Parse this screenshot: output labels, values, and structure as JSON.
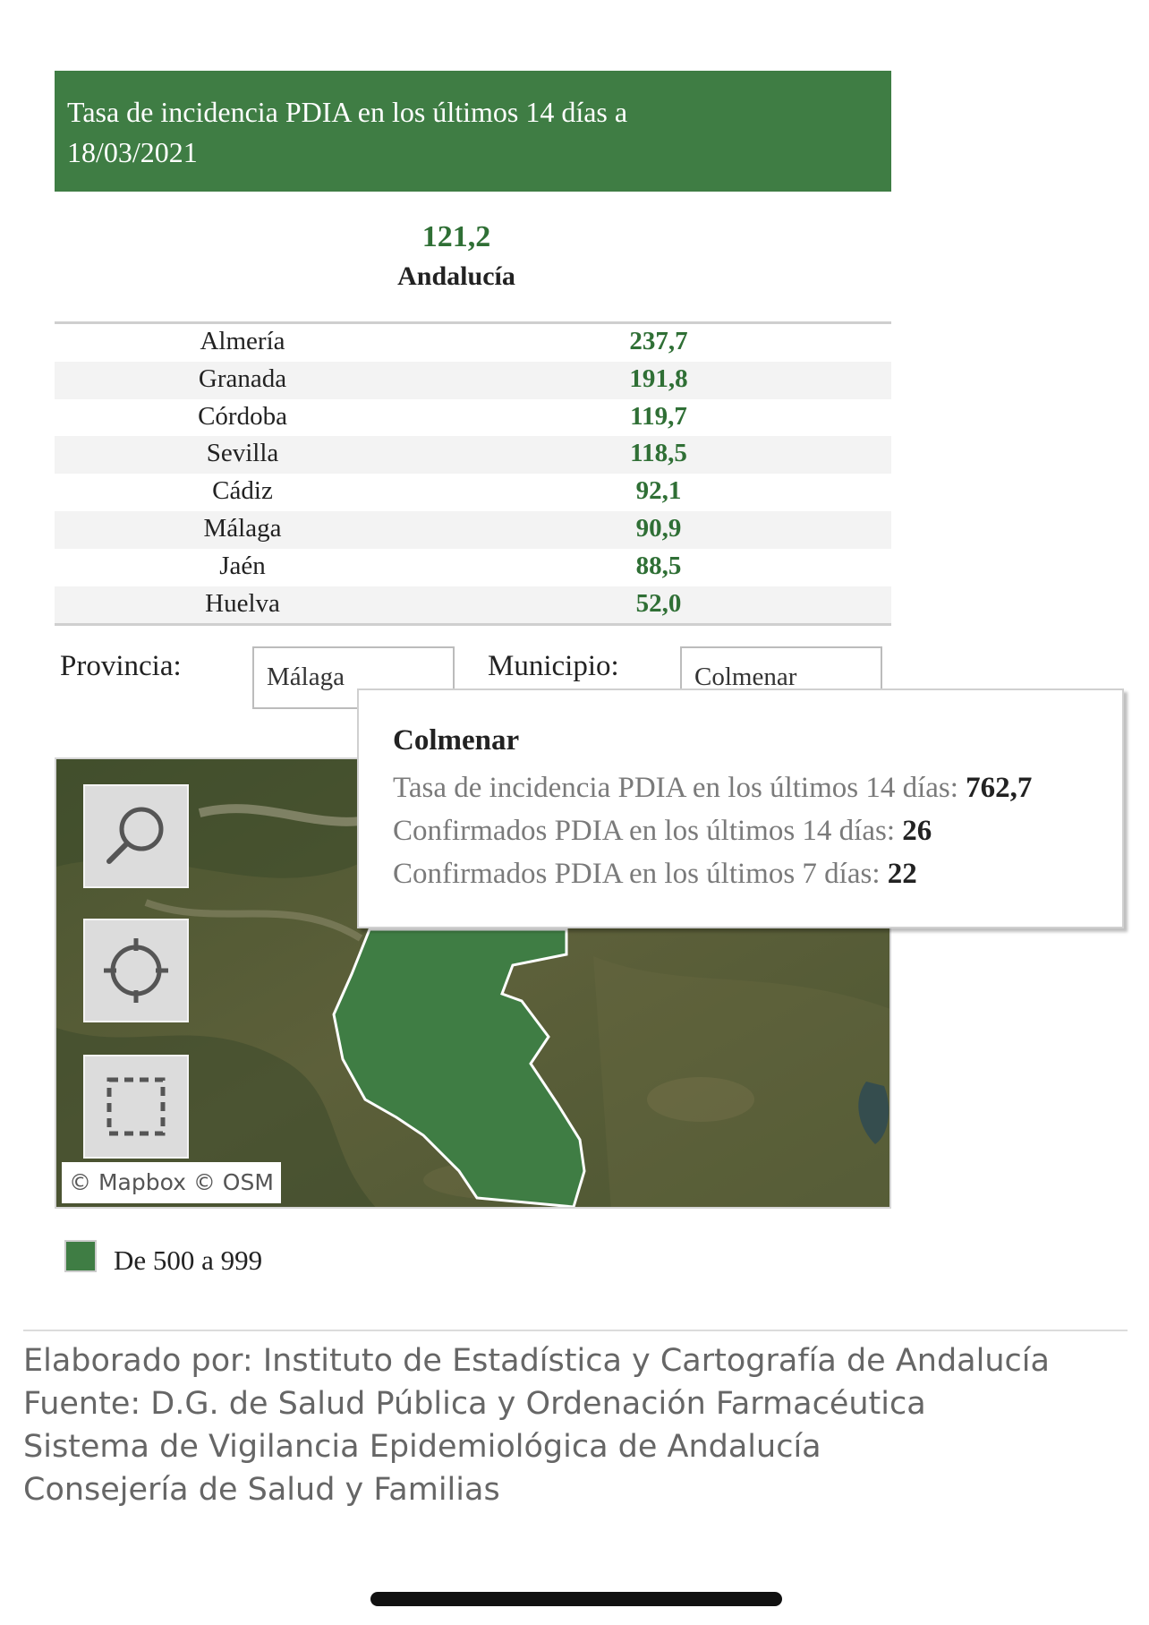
{
  "header": {
    "title_line1": "Tasa de incidencia PDIA en los últimos 14 días a",
    "title_line2": "18/03/2021"
  },
  "total": {
    "value": "121,2",
    "label": "Andalucía"
  },
  "provinces": [
    {
      "name": "Almería",
      "value": "237,7"
    },
    {
      "name": "Granada",
      "value": "191,8"
    },
    {
      "name": "Córdoba",
      "value": "119,7"
    },
    {
      "name": "Sevilla",
      "value": "118,5"
    },
    {
      "name": "Cádiz",
      "value": "92,1"
    },
    {
      "name": "Málaga",
      "value": "90,9"
    },
    {
      "name": "Jaén",
      "value": "88,5"
    },
    {
      "name": "Huelva",
      "value": "52,0"
    }
  ],
  "filters": {
    "provincia_label": "Provincia:",
    "provincia_value": "Málaga",
    "municipio_label": "Municipio:",
    "municipio_value": "Colmenar"
  },
  "map": {
    "controls": [
      "search-icon",
      "locate-icon",
      "select-area-icon"
    ],
    "attribution": "© Mapbox  © OSM",
    "region_color": "#3f7d44"
  },
  "tooltip": {
    "title": "Colmenar",
    "line1_label": "Tasa de incidencia PDIA en los últimos 14 días: ",
    "line1_value": "762,7",
    "line2_label": "Confirmados PDIA en los últimos 14 días: ",
    "line2_value": "26",
    "line3_label": "Confirmados PDIA en los últimos 7 días: ",
    "line3_value": "22"
  },
  "legend": {
    "label": "De 500 a 999",
    "color": "#3f7d44"
  },
  "footer": [
    "Elaborado por: Instituto de Estadística y Cartografía de Andalucía",
    "Fuente: D.G. de Salud Pública y Ordenación Farmacéutica",
    "Sistema de Vigilancia Epidemiológica de Andalucía",
    "Consejería de Salud y Familias"
  ]
}
